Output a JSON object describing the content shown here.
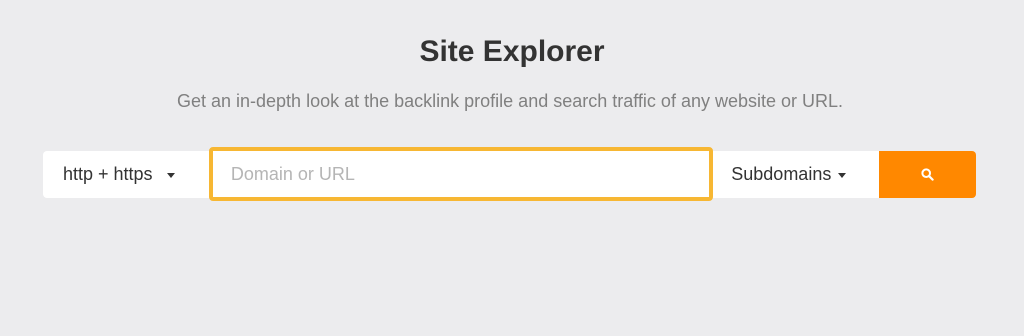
{
  "header": {
    "title": "Site Explorer",
    "subtitle": "Get an in-depth look at the backlink profile and search traffic of any website or URL."
  },
  "search": {
    "protocol_label": "http + https",
    "protocol_icon": "chevron-down-icon",
    "input_value": "",
    "input_placeholder": "Domain or URL",
    "scope_label": "Subdomains",
    "scope_icon": "chevron-down-icon",
    "button_icon": "search-icon"
  },
  "colors": {
    "background": "#ececee",
    "accent": "#ff8800",
    "input_focus_border": "#f7b733",
    "title_text": "#333333",
    "subtitle_text": "#808080",
    "placeholder_text": "#b5b5b5"
  }
}
